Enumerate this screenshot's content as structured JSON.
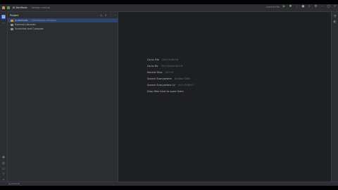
{
  "titlebar": {
    "project_label": "JS DevTools",
    "branch_label": "Version control",
    "run_config": "Current File",
    "icons": [
      "project-badge",
      "chevron-down",
      "run",
      "debug",
      "stop",
      "search",
      "settings"
    ]
  },
  "project_panel": {
    "title": "Project",
    "tree": [
      {
        "label": "js-devtools",
        "path": "~/Desktop/js-devtools"
      },
      {
        "label": "External Libraries",
        "path": ""
      },
      {
        "label": "Scratches and Consoles",
        "path": ""
      }
    ]
  },
  "editor_hints": [
    {
      "label": "Go to File",
      "shortcut": "Ctrl+Shift+N"
    },
    {
      "label": "Go to Re",
      "shortcut": "Ctrl+Shift+Alt+N"
    },
    {
      "label": "Recent Files",
      "shortcut": "Ctrl+E"
    },
    {
      "label": "Search Everywhere",
      "shortcut": "Double Shift"
    },
    {
      "label": "Search Everywhere (V",
      "shortcut": "Ctrl+Shift+F"
    },
    {
      "label": "Drop files here to open them",
      "shortcut": ""
    }
  ],
  "statusbar": {
    "text": "js-devtools"
  },
  "colors": {
    "background": "#1e1f22",
    "panel": "#2b2d30",
    "accent": "#3574f0",
    "selection": "#2e436e"
  }
}
